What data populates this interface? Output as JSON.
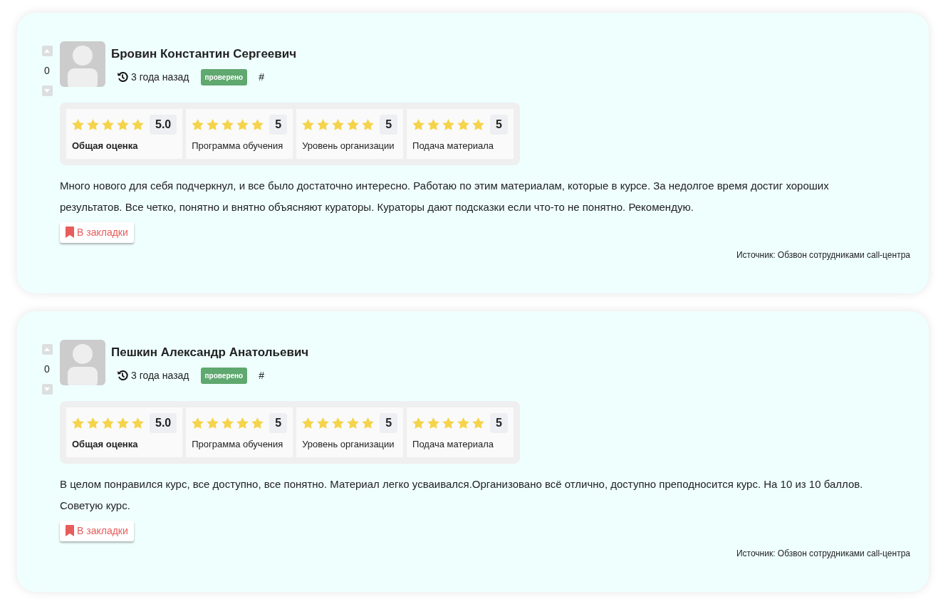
{
  "reviews": [
    {
      "votes": "0",
      "author": "Бровин Константин Сергеевич",
      "time": "3 года назад",
      "badge": "проверено",
      "anchor": "#",
      "ratings": [
        {
          "kind": "overall",
          "stars": 5,
          "score": "5.0",
          "label": "Общая оценка"
        },
        {
          "kind": "criterion",
          "stars": 5,
          "score": "5",
          "label": "Программа обучения"
        },
        {
          "kind": "criterion",
          "stars": 5,
          "score": "5",
          "label": "Уровень организации"
        },
        {
          "kind": "criterion",
          "stars": 5,
          "score": "5",
          "label": "Подача материала"
        }
      ],
      "text": "Много нового для себя подчеркнул, и все было достаточно интересно. Работаю по этим материалам, которые в курсе. За недолгое время достиг хороших результатов. Все четко, понятно и внятно объясняют кураторы. Кураторы дают подсказки если что-то не понятно. Рекомендую.",
      "bookmark": "В закладки",
      "source": "Источник: Обзвон сотрудниками call-центра"
    },
    {
      "votes": "0",
      "author": "Пешкин Александр Анатольевич",
      "time": "3 года назад",
      "badge": "проверено",
      "anchor": "#",
      "ratings": [
        {
          "kind": "overall",
          "stars": 5,
          "score": "5.0",
          "label": "Общая оценка"
        },
        {
          "kind": "criterion",
          "stars": 5,
          "score": "5",
          "label": "Программа обучения"
        },
        {
          "kind": "criterion",
          "stars": 5,
          "score": "5",
          "label": "Уровень организации"
        },
        {
          "kind": "criterion",
          "stars": 5,
          "score": "5",
          "label": "Подача материала"
        }
      ],
      "text": "В целом понравился курс, все доступно, все понятно. Материал легко усваивался.Организовано всё отлично, доступно преподносится курс. На 10 из 10 баллов. Советую курс.",
      "bookmark": "В закладки",
      "source": "Источник: Обзвон сотрудниками call-центра"
    }
  ]
}
